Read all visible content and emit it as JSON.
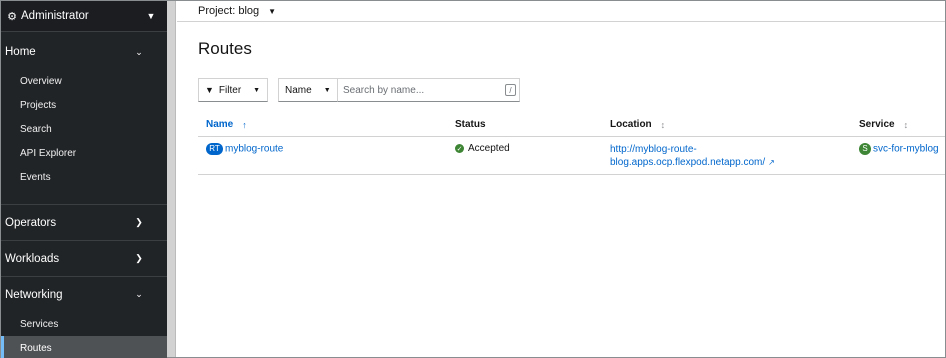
{
  "sidebar": {
    "perspective": "Administrator",
    "sections": {
      "home": {
        "label": "Home",
        "items": [
          "Overview",
          "Projects",
          "Search",
          "API Explorer",
          "Events"
        ]
      },
      "operators": {
        "label": "Operators"
      },
      "workloads": {
        "label": "Workloads"
      },
      "networking": {
        "label": "Networking",
        "items": [
          "Services",
          "Routes"
        ],
        "active_item": "Routes"
      }
    }
  },
  "header": {
    "project_label": "Project: blog"
  },
  "page": {
    "title": "Routes"
  },
  "toolbar": {
    "filter_label": "Filter",
    "name_select": "Name",
    "search_placeholder": "Search by name...",
    "search_value": "",
    "shortcut_key": "/"
  },
  "table": {
    "columns": [
      "Name",
      "Status",
      "Location",
      "Service"
    ],
    "sorted_column": "Name",
    "rows": [
      {
        "badge": "RT",
        "name": "myblog-route",
        "status": "Accepted",
        "location_line1": "http://myblog-route-",
        "location_line2": "blog.apps.ocp.flexpod.netapp.com/",
        "service_badge": "S",
        "service": "svc-for-myblog"
      }
    ]
  },
  "colors": {
    "link": "#0066cc",
    "sidebar_bg": "#212427",
    "success": "#3e8635",
    "route_badge": "#0066cc"
  },
  "icons": [
    "gear-icon",
    "chevron-down-icon",
    "chevron-right-icon",
    "filter-icon",
    "caret-down-icon",
    "sort-ascending-icon",
    "sort-icon",
    "check-circle-icon",
    "external-link-icon"
  ]
}
